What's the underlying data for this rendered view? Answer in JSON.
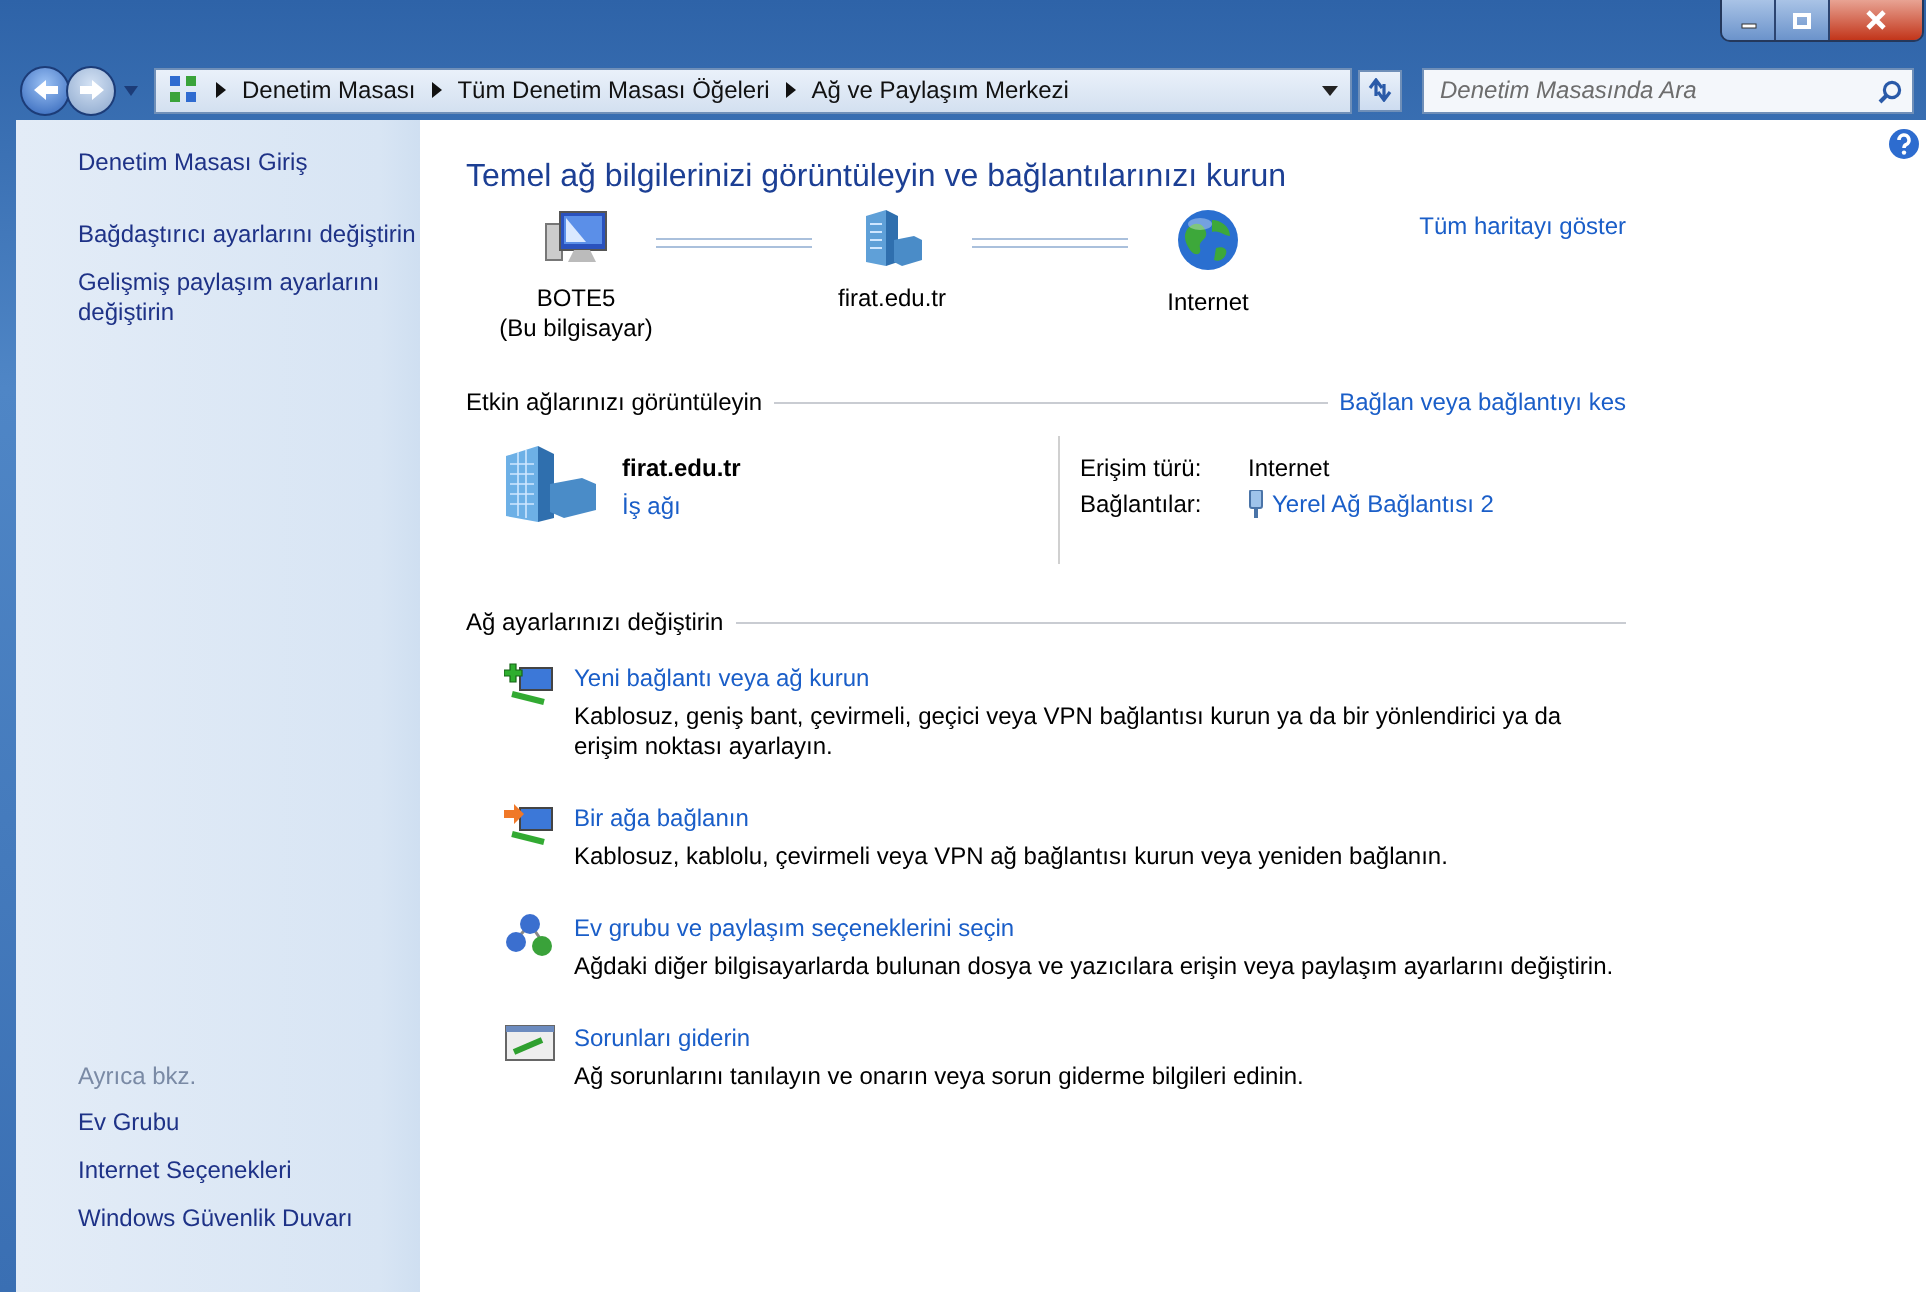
{
  "address_bar": {
    "breadcrumbs": [
      "Denetim Masası",
      "Tüm Denetim Masası Öğeleri",
      "Ağ ve Paylaşım Merkezi"
    ]
  },
  "search": {
    "placeholder": "Denetim Masasında Ara"
  },
  "sidebar": {
    "links": [
      "Denetim Masası Giriş",
      "Bağdaştırıcı ayarlarını değiştirin",
      "Gelişmiş paylaşım ayarlarını değiştirin"
    ],
    "see_also_heading": "Ayrıca bkz.",
    "see_also": [
      "Ev Grubu",
      "Internet Seçenekleri",
      "Windows Güvenlik Duvarı"
    ]
  },
  "main": {
    "title": "Temel ağ bilgilerinizi görüntüleyin ve bağlantılarınızı kurun",
    "map_link": "Tüm haritayı göster",
    "map_nodes": [
      {
        "kind": "computer",
        "name": "BOTE5",
        "subtitle": "(Bu bilgisayar)"
      },
      {
        "kind": "network",
        "name": "firat.edu.tr"
      },
      {
        "kind": "internet",
        "name": "Internet"
      }
    ],
    "active_networks": {
      "heading": "Etkin ağlarınızı görüntüleyin",
      "link": "Bağlan veya bağlantıyı kes",
      "network_name": "firat.edu.tr",
      "network_type": "İş ağı",
      "access_label": "Erişim türü:",
      "access_value": "Internet",
      "connections_label": "Bağlantılar:",
      "connection": "Yerel Ağ Bağlantısı 2"
    },
    "settings": {
      "heading": "Ağ ayarlarınızı değiştirin",
      "tasks": [
        {
          "kind": "new-connection",
          "title": "Yeni bağlantı veya ağ kurun",
          "description": "Kablosuz, geniş bant, çevirmeli, geçici veya VPN bağlantısı kurun ya da bir yönlendirici ya da erişim noktası ayarlayın."
        },
        {
          "kind": "connect",
          "title": "Bir ağa bağlanın",
          "description": "Kablosuz, kablolu, çevirmeli veya VPN ağ bağlantısı kurun veya yeniden bağlanın."
        },
        {
          "kind": "homegroup",
          "title": "Ev grubu ve paylaşım seçeneklerini seçin",
          "description": "Ağdaki diğer bilgisayarlarda bulunan dosya ve yazıcılara erişin veya paylaşım ayarlarını değiştirin."
        },
        {
          "kind": "troubleshoot",
          "title": "Sorunları giderin",
          "description": "Ağ sorunlarını tanılayın ve onarın veya sorun giderme bilgileri edinin."
        }
      ]
    }
  }
}
